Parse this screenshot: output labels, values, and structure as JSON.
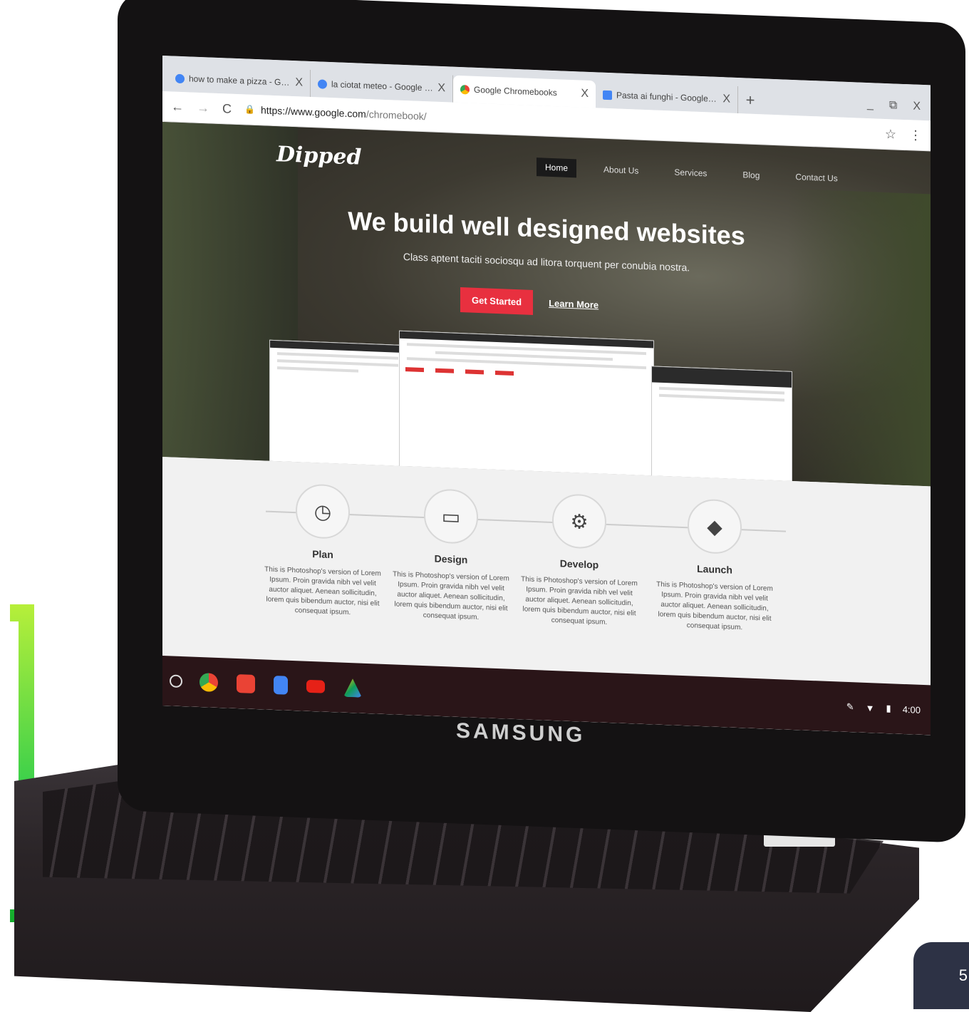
{
  "browser": {
    "tabs": [
      {
        "title": "how to make a pizza - Googl",
        "favicon_color": "#4285f4",
        "active": false
      },
      {
        "title": "la ciotat meteo - Google Sear",
        "favicon_color": "#4285f4",
        "active": false
      },
      {
        "title": "Google Chromebooks",
        "favicon_color": "#ea4335",
        "active": true
      },
      {
        "title": "Pasta ai funghi - Google Docs",
        "favicon_color": "#4285f4",
        "active": false
      }
    ],
    "url_host": "https://www.google.com",
    "url_path": "/chromebook/",
    "close_glyph": "X",
    "new_tab_glyph": "+",
    "window_controls": [
      "_",
      "⧉",
      "X"
    ]
  },
  "site": {
    "logo": "Dipped",
    "nav": [
      "Home",
      "About Us",
      "Services",
      "Blog",
      "Contact Us"
    ],
    "headline": "We build well designed websites",
    "subheadline": "Class aptent taciti sociosqu ad litora torquent per conubia nostra.",
    "primary_cta": "Get Started",
    "secondary_cta": "Learn More",
    "steps": [
      {
        "title": "Plan",
        "icon": "clock-icon",
        "text": "This is Photoshop's version of Lorem Ipsum. Proin gravida nibh vel velit auctor aliquet. Aenean sollicitudin, lorem quis bibendum auctor, nisi elit consequat ipsum."
      },
      {
        "title": "Design",
        "icon": "laptop-icon",
        "text": "This is Photoshop's version of Lorem Ipsum. Proin gravida nibh vel velit auctor aliquet. Aenean sollicitudin, lorem quis bibendum auctor, nisi elit consequat ipsum."
      },
      {
        "title": "Develop",
        "icon": "gear-icon",
        "text": "This is Photoshop's version of Lorem Ipsum. Proin gravida nibh vel velit auctor aliquet. Aenean sollicitudin, lorem quis bibendum auctor, nisi elit consequat ipsum."
      },
      {
        "title": "Launch",
        "icon": "box-icon",
        "text": "This is Photoshop's version of Lorem Ipsum. Proin gravida nibh vel velit auctor aliquet. Aenean sollicitudin, lorem quis bibendum auctor, nisi elit consequat ipsum."
      }
    ]
  },
  "shelf": {
    "apps": [
      {
        "name": "chrome-icon",
        "color": "#fbbc05"
      },
      {
        "name": "gmail-icon",
        "color": "#ea4335"
      },
      {
        "name": "docs-icon",
        "color": "#4285f4"
      },
      {
        "name": "youtube-icon",
        "color": "#e62117"
      },
      {
        "name": "drive-icon",
        "color": "#0f9d58"
      }
    ],
    "time": "4:00"
  },
  "device": {
    "brand": "SAMSUNG"
  },
  "slide": {
    "page_number": "5"
  }
}
